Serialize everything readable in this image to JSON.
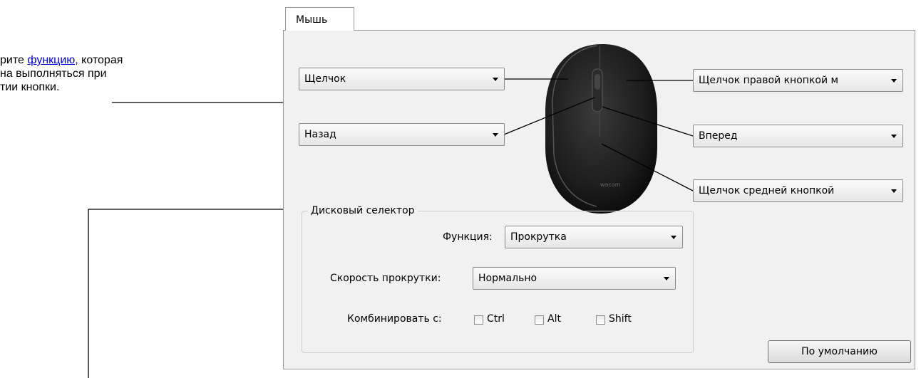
{
  "callout": {
    "line1_prefix": "рите ",
    "line1_link": "функцию,",
    "line1_suffix": " которая",
    "line2": "на выполняться при",
    "line3": "тии кнопки."
  },
  "tab": {
    "label": "Мышь"
  },
  "buttons": {
    "left": {
      "value": "Щелчок"
    },
    "back": {
      "value": "Назад"
    },
    "right": {
      "value": "Щелчок правой кнопкой м"
    },
    "forward": {
      "value": "Вперед"
    },
    "middle": {
      "value": "Щелчок средней кнопкой"
    }
  },
  "mouse": {
    "brand": "wacom"
  },
  "wheel": {
    "title": "Дисковый селектор",
    "function_label": "Функция:",
    "function_value": "Прокрутка",
    "speed_label": "Скорость прокрутки:",
    "speed_value": "Нормально",
    "combine_label": "Комбинировать с:",
    "modifiers": [
      {
        "label": "Ctrl",
        "checked": false
      },
      {
        "label": "Alt",
        "checked": false
      },
      {
        "label": "Shift",
        "checked": false
      }
    ]
  },
  "default_button": {
    "label": "По умолчанию"
  },
  "colors": {
    "link": "#0000cc",
    "panel_bg": "#f1f1f1",
    "mouse_body": "#1c1c1c"
  }
}
